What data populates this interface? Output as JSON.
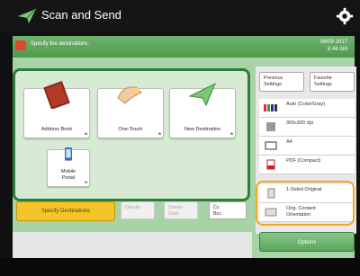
{
  "header": {
    "title": "Scan and Send"
  },
  "message": {
    "text": "Specify the destinations.",
    "date": "06/09 2017",
    "time": "8:46 AM"
  },
  "tiles": [
    {
      "label": "Address Book",
      "icon": "address-book-icon"
    },
    {
      "label": "One-Touch",
      "icon": "one-touch-icon"
    },
    {
      "label": "New Destination",
      "icon": "new-destination-icon"
    },
    {
      "label": "Mobile\nPortal",
      "icon": "mobile-portal-icon"
    }
  ],
  "actions": {
    "specify": "Specify Destinations",
    "details": "Details",
    "delete": "Delete\nDest.",
    "cc_bcc": "Cc\nBcc"
  },
  "settings": {
    "previous": "Previous\nSettings",
    "favorite": "Favorite\nSettings",
    "color": "Auto (Color/Gray)",
    "resolution": "300x300 dpi",
    "size": "A4",
    "format": "PDF (Compact)",
    "sided": "1-Sided Original",
    "orientation": "Orig. Content\nOrientation",
    "options": "Options"
  },
  "colors": {
    "accent": "#f3c52b",
    "header": "#151515",
    "green": "#4f9a4e",
    "highlight": "#f5a623"
  }
}
